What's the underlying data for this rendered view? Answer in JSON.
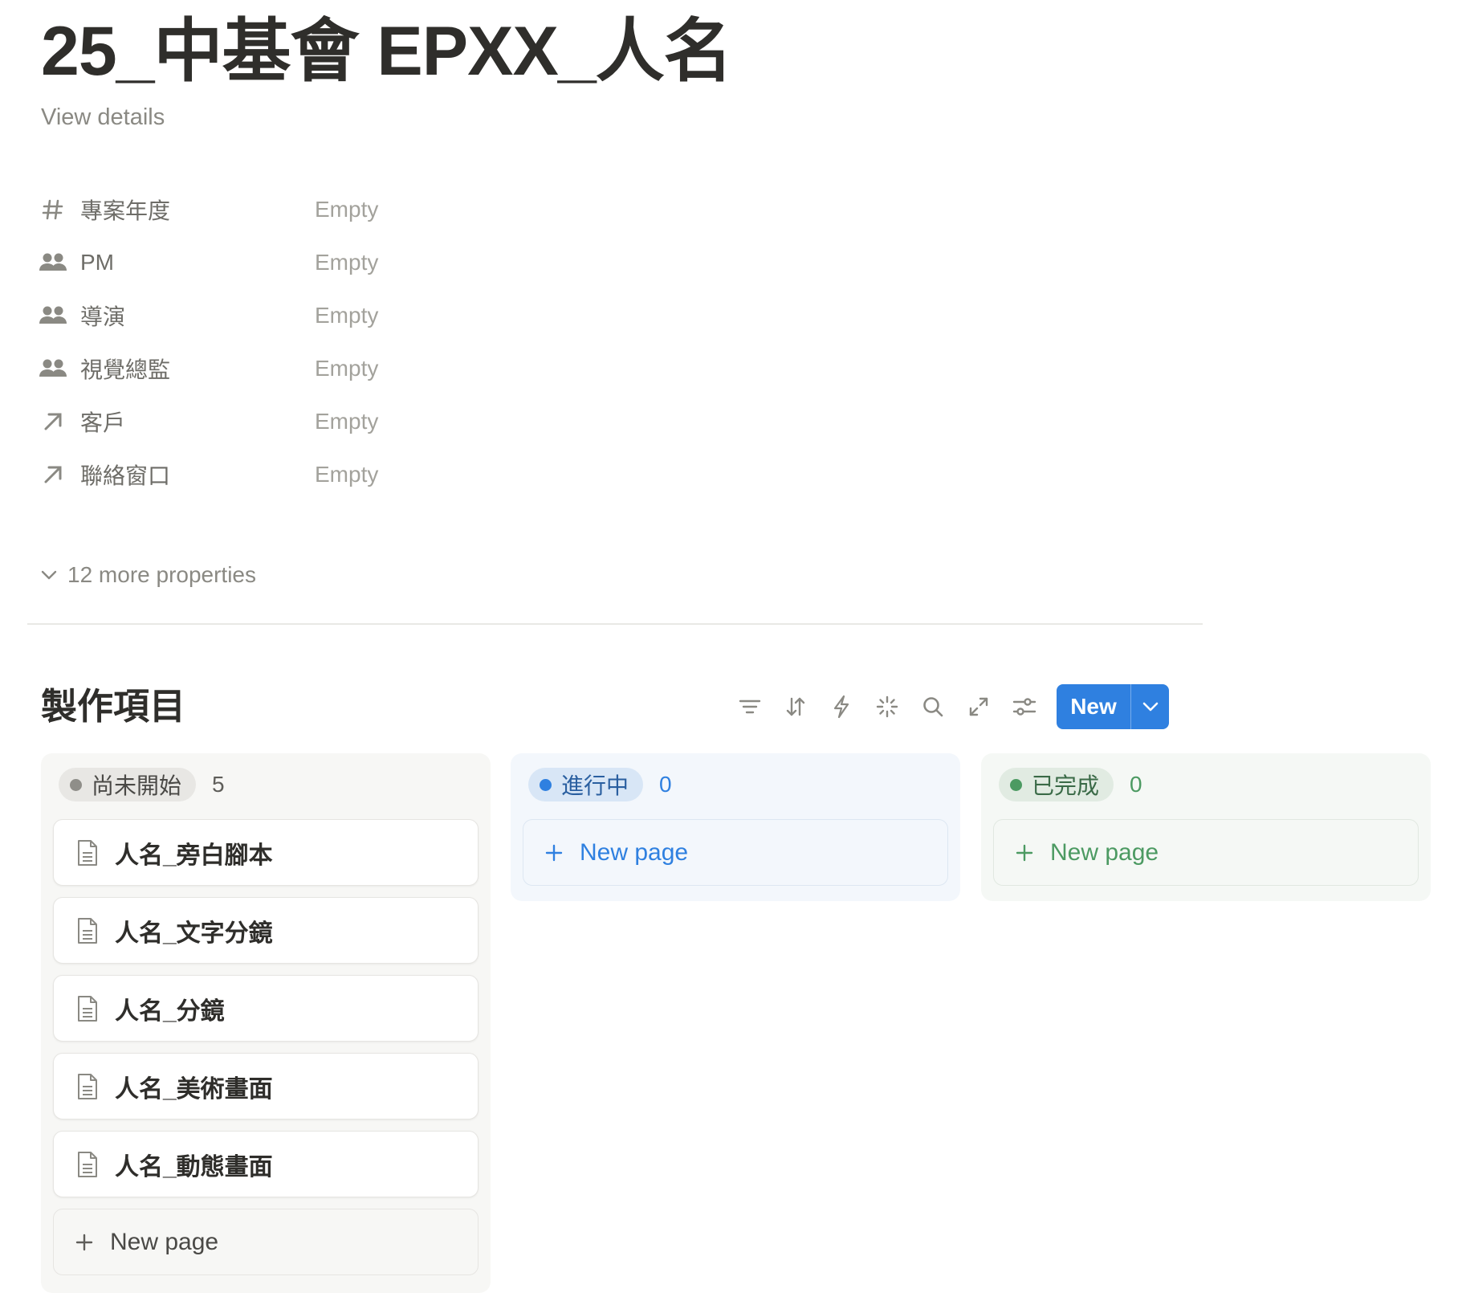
{
  "page": {
    "title": "25_中基會 EPXX_人名",
    "view_details": "View details"
  },
  "properties": [
    {
      "icon": "hash-icon",
      "name": "專案年度",
      "value": "Empty"
    },
    {
      "icon": "people-icon",
      "name": "PM",
      "value": "Empty"
    },
    {
      "icon": "people-icon",
      "name": "導演",
      "value": "Empty"
    },
    {
      "icon": "people-icon",
      "name": "視覺總監",
      "value": "Empty"
    },
    {
      "icon": "relation-arrow-icon",
      "name": "客戶",
      "value": "Empty"
    },
    {
      "icon": "relation-arrow-icon",
      "name": "聯絡窗口",
      "value": "Empty"
    }
  ],
  "more_properties": "12 more properties",
  "database": {
    "title": "製作項目",
    "toolbar": [
      "filter-icon",
      "sort-icon",
      "automation-icon",
      "ai-sparkle-icon",
      "search-icon",
      "expand-icon",
      "settings-icon"
    ],
    "new_label": "New"
  },
  "columns": [
    {
      "status": "尚未開始",
      "count": "5",
      "color": "#8f8e89",
      "cards": [
        "人名_旁白腳本",
        "人名_文字分鏡",
        "人名_分鏡",
        "人名_美術畫面",
        "人名_動態畫面"
      ],
      "new_page": "New page"
    },
    {
      "status": "進行中",
      "count": "0",
      "color": "#2f80e0",
      "cards": [],
      "new_page": "New page"
    },
    {
      "status": "已完成",
      "count": "0",
      "color": "#4c9a62",
      "cards": [],
      "new_page": "New page"
    }
  ]
}
